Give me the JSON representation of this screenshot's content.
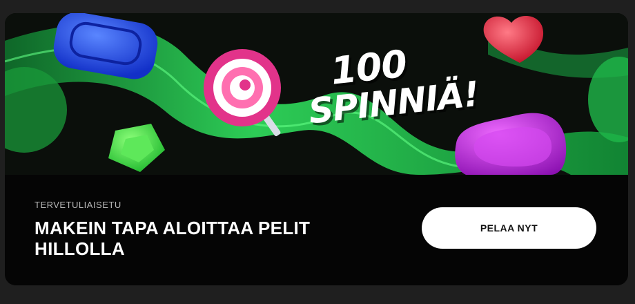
{
  "banner": {
    "promo_number": "100",
    "promo_word": "SPINNIÄ!"
  },
  "offer": {
    "eyebrow": "TERVETULIAISETU",
    "title": "MAKEIN TAPA ALOITTAA PELIT HILLOLLA"
  },
  "cta": {
    "label": "PELAA NYT"
  },
  "colors": {
    "accent_green": "#2fd65a",
    "candy_blue": "#1f47e6",
    "candy_pink": "#e2338a",
    "candy_red": "#e2233a",
    "candy_purple": "#b61fd6",
    "card_bg": "#050505",
    "cta_bg": "#ffffff"
  },
  "icons": [
    "blue-candy-icon",
    "lollipop-icon",
    "heart-candy-icon",
    "green-candy-icon",
    "purple-candy-icon"
  ]
}
